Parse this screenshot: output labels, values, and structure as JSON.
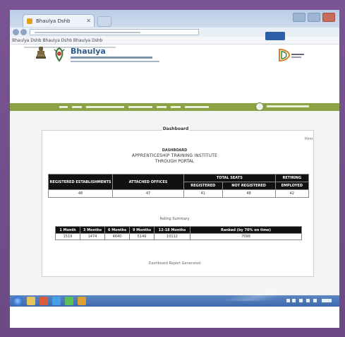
{
  "browser": {
    "tab_title": "Bhaulya Dshb",
    "bookmarks_text": "Bhaulya Dshb  Bhaulya Dshb  Bhaulya Dshb"
  },
  "site": {
    "brand_title": "Bhaulya",
    "accent_green": "#8ca244",
    "accent_blue": "#2d5fa6"
  },
  "panel": {
    "legend": "Dashboard",
    "print_label": "Print",
    "title_line1": "DASHBOARD",
    "title_line2": "APPRENTICESHIP TRAINING INSTITUTE",
    "title_line3": "THROUGH PORTAL"
  },
  "table1": {
    "headers": [
      "REGISTERED ESTABLISHMENTS",
      "ATTACHED OFFICES",
      "TOTAL SEATS",
      "RETIRING"
    ],
    "subheaders": [
      "REGISTERED",
      "NOT REGISTERED",
      "EMPLOYED"
    ],
    "row": [
      "48",
      "47",
      "41",
      "48",
      "42"
    ]
  },
  "rating": {
    "label": "Rating Summary",
    "headers": [
      "1 Month",
      "3 Months",
      "6 Months",
      "9 Months",
      "12-18 Months",
      "Ranked (by 70% on time)"
    ],
    "row": [
      "1519",
      "1474",
      "4640",
      "5149",
      "10112",
      "7099"
    ]
  },
  "footer_note": "Dashboard Report Generated"
}
